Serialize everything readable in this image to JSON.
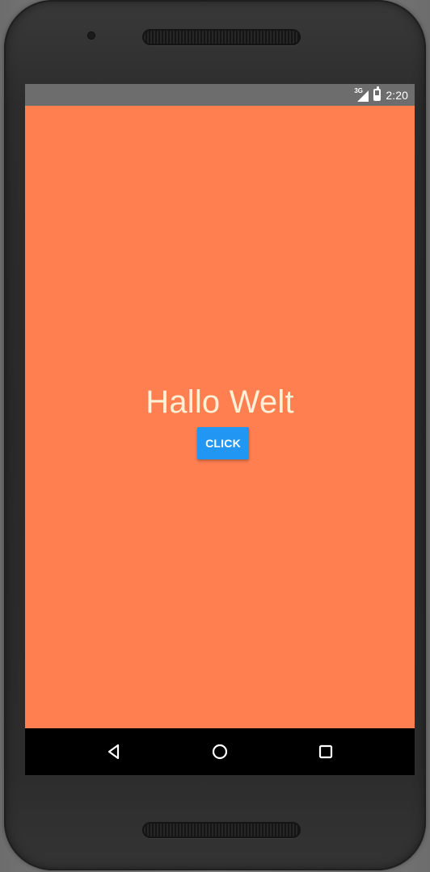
{
  "status_bar": {
    "network_type": "3G",
    "time": "2:20",
    "icons": {
      "signal": "signal-icon",
      "battery": "battery-icon"
    }
  },
  "main": {
    "hello_text": "Hallo Welt",
    "button_label": "CLICK"
  },
  "navigation": {
    "icons": [
      "back-icon",
      "home-icon",
      "recents-icon"
    ]
  },
  "colors": {
    "screen_background": "#ff7f50",
    "status_bar": "#6d6d6d",
    "button": "#2196f3",
    "text": "#fff0d6",
    "nav_bar": "#000000"
  }
}
